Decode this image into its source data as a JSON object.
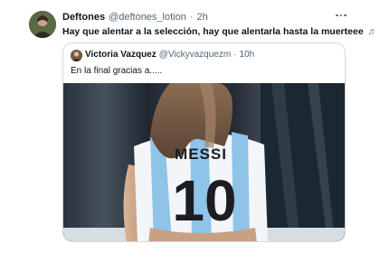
{
  "tweet": {
    "author_name": "Deftones",
    "handle": "@deftones_lotion",
    "separator": "·",
    "time": "2h",
    "text": "Hay que alentar a la selección, hay que alentarla hasta la muerteee",
    "more_icon": "more-horizontal-icon",
    "emoji_icon": "musical-notes-icon"
  },
  "quoted_tweet": {
    "author_name": "Victoria Vazquez",
    "handle": "@Vickyvazquezm",
    "separator": "·",
    "time": "10h",
    "text": "En la final gracias a.....",
    "jersey_name": "MESSI",
    "jersey_number": "10"
  },
  "colors": {
    "text": "#0f1419",
    "muted": "#536471",
    "border": "#cfd9de",
    "accent": "#3b94d9",
    "jersey_blue": "#8fc3e8"
  }
}
